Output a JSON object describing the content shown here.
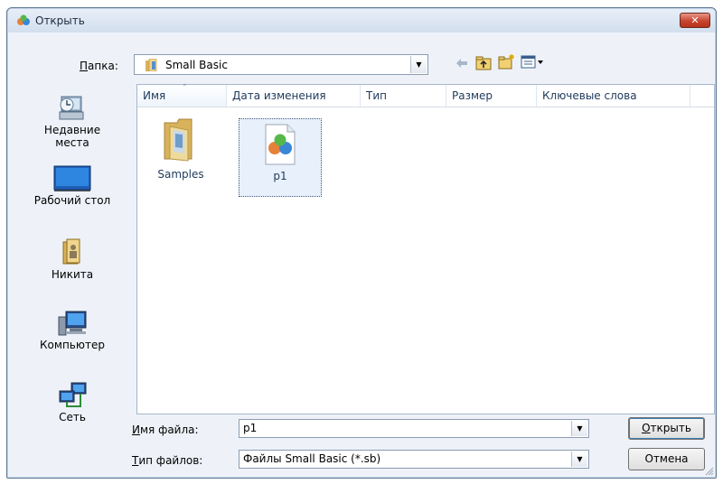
{
  "window": {
    "title": "Открыть"
  },
  "folder": {
    "label_hotkey": "П",
    "label_rest": "апка:",
    "value": "Small Basic"
  },
  "columns": [
    "Имя",
    "Дата изменения",
    "Тип",
    "Размер",
    "Ключевые слова"
  ],
  "places": [
    {
      "label": "Недавние места",
      "icon": "recent-places-icon"
    },
    {
      "label": "Рабочий стол",
      "icon": "desktop-icon"
    },
    {
      "label": "Никита",
      "icon": "user-folder-icon"
    },
    {
      "label": "Компьютер",
      "icon": "computer-icon"
    },
    {
      "label": "Сеть",
      "icon": "network-icon"
    }
  ],
  "files": [
    {
      "name": "Samples",
      "icon": "folder-icon"
    },
    {
      "name": "p1",
      "icon": "small-basic-file-icon"
    }
  ],
  "filename": {
    "label_hotkey": "И",
    "label_rest": "мя файла:",
    "value": "p1"
  },
  "filetype": {
    "label_hotkey": "Т",
    "label_rest": "ип файлов:",
    "value": "Файлы Small Basic (*.sb)"
  },
  "buttons": {
    "open_hotkey": "О",
    "open_rest": "ткрыть",
    "cancel": "Отмена"
  },
  "colors": {
    "accent": "#3c7fb1",
    "close": "#c7452f"
  }
}
